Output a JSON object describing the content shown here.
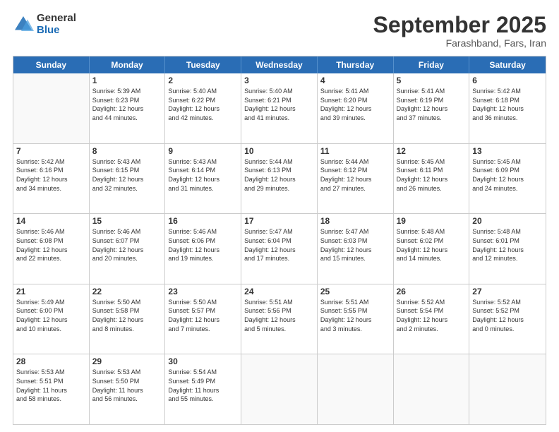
{
  "logo": {
    "general": "General",
    "blue": "Blue"
  },
  "header": {
    "month": "September 2025",
    "location": "Farashband, Fars, Iran"
  },
  "weekdays": [
    "Sunday",
    "Monday",
    "Tuesday",
    "Wednesday",
    "Thursday",
    "Friday",
    "Saturday"
  ],
  "rows": [
    [
      {
        "day": "",
        "empty": true
      },
      {
        "day": "1",
        "rise": "Sunrise: 5:39 AM",
        "set": "Sunset: 6:23 PM",
        "day_hours": "Daylight: 12 hours",
        "day_min": "and 44 minutes."
      },
      {
        "day": "2",
        "rise": "Sunrise: 5:40 AM",
        "set": "Sunset: 6:22 PM",
        "day_hours": "Daylight: 12 hours",
        "day_min": "and 42 minutes."
      },
      {
        "day": "3",
        "rise": "Sunrise: 5:40 AM",
        "set": "Sunset: 6:21 PM",
        "day_hours": "Daylight: 12 hours",
        "day_min": "and 41 minutes."
      },
      {
        "day": "4",
        "rise": "Sunrise: 5:41 AM",
        "set": "Sunset: 6:20 PM",
        "day_hours": "Daylight: 12 hours",
        "day_min": "and 39 minutes."
      },
      {
        "day": "5",
        "rise": "Sunrise: 5:41 AM",
        "set": "Sunset: 6:19 PM",
        "day_hours": "Daylight: 12 hours",
        "day_min": "and 37 minutes."
      },
      {
        "day": "6",
        "rise": "Sunrise: 5:42 AM",
        "set": "Sunset: 6:18 PM",
        "day_hours": "Daylight: 12 hours",
        "day_min": "and 36 minutes."
      }
    ],
    [
      {
        "day": "7",
        "rise": "Sunrise: 5:42 AM",
        "set": "Sunset: 6:16 PM",
        "day_hours": "Daylight: 12 hours",
        "day_min": "and 34 minutes."
      },
      {
        "day": "8",
        "rise": "Sunrise: 5:43 AM",
        "set": "Sunset: 6:15 PM",
        "day_hours": "Daylight: 12 hours",
        "day_min": "and 32 minutes."
      },
      {
        "day": "9",
        "rise": "Sunrise: 5:43 AM",
        "set": "Sunset: 6:14 PM",
        "day_hours": "Daylight: 12 hours",
        "day_min": "and 31 minutes."
      },
      {
        "day": "10",
        "rise": "Sunrise: 5:44 AM",
        "set": "Sunset: 6:13 PM",
        "day_hours": "Daylight: 12 hours",
        "day_min": "and 29 minutes."
      },
      {
        "day": "11",
        "rise": "Sunrise: 5:44 AM",
        "set": "Sunset: 6:12 PM",
        "day_hours": "Daylight: 12 hours",
        "day_min": "and 27 minutes."
      },
      {
        "day": "12",
        "rise": "Sunrise: 5:45 AM",
        "set": "Sunset: 6:11 PM",
        "day_hours": "Daylight: 12 hours",
        "day_min": "and 26 minutes."
      },
      {
        "day": "13",
        "rise": "Sunrise: 5:45 AM",
        "set": "Sunset: 6:09 PM",
        "day_hours": "Daylight: 12 hours",
        "day_min": "and 24 minutes."
      }
    ],
    [
      {
        "day": "14",
        "rise": "Sunrise: 5:46 AM",
        "set": "Sunset: 6:08 PM",
        "day_hours": "Daylight: 12 hours",
        "day_min": "and 22 minutes."
      },
      {
        "day": "15",
        "rise": "Sunrise: 5:46 AM",
        "set": "Sunset: 6:07 PM",
        "day_hours": "Daylight: 12 hours",
        "day_min": "and 20 minutes."
      },
      {
        "day": "16",
        "rise": "Sunrise: 5:46 AM",
        "set": "Sunset: 6:06 PM",
        "day_hours": "Daylight: 12 hours",
        "day_min": "and 19 minutes."
      },
      {
        "day": "17",
        "rise": "Sunrise: 5:47 AM",
        "set": "Sunset: 6:04 PM",
        "day_hours": "Daylight: 12 hours",
        "day_min": "and 17 minutes."
      },
      {
        "day": "18",
        "rise": "Sunrise: 5:47 AM",
        "set": "Sunset: 6:03 PM",
        "day_hours": "Daylight: 12 hours",
        "day_min": "and 15 minutes."
      },
      {
        "day": "19",
        "rise": "Sunrise: 5:48 AM",
        "set": "Sunset: 6:02 PM",
        "day_hours": "Daylight: 12 hours",
        "day_min": "and 14 minutes."
      },
      {
        "day": "20",
        "rise": "Sunrise: 5:48 AM",
        "set": "Sunset: 6:01 PM",
        "day_hours": "Daylight: 12 hours",
        "day_min": "and 12 minutes."
      }
    ],
    [
      {
        "day": "21",
        "rise": "Sunrise: 5:49 AM",
        "set": "Sunset: 6:00 PM",
        "day_hours": "Daylight: 12 hours",
        "day_min": "and 10 minutes."
      },
      {
        "day": "22",
        "rise": "Sunrise: 5:50 AM",
        "set": "Sunset: 5:58 PM",
        "day_hours": "Daylight: 12 hours",
        "day_min": "and 8 minutes."
      },
      {
        "day": "23",
        "rise": "Sunrise: 5:50 AM",
        "set": "Sunset: 5:57 PM",
        "day_hours": "Daylight: 12 hours",
        "day_min": "and 7 minutes."
      },
      {
        "day": "24",
        "rise": "Sunrise: 5:51 AM",
        "set": "Sunset: 5:56 PM",
        "day_hours": "Daylight: 12 hours",
        "day_min": "and 5 minutes."
      },
      {
        "day": "25",
        "rise": "Sunrise: 5:51 AM",
        "set": "Sunset: 5:55 PM",
        "day_hours": "Daylight: 12 hours",
        "day_min": "and 3 minutes."
      },
      {
        "day": "26",
        "rise": "Sunrise: 5:52 AM",
        "set": "Sunset: 5:54 PM",
        "day_hours": "Daylight: 12 hours",
        "day_min": "and 2 minutes."
      },
      {
        "day": "27",
        "rise": "Sunrise: 5:52 AM",
        "set": "Sunset: 5:52 PM",
        "day_hours": "Daylight: 12 hours",
        "day_min": "and 0 minutes."
      }
    ],
    [
      {
        "day": "28",
        "rise": "Sunrise: 5:53 AM",
        "set": "Sunset: 5:51 PM",
        "day_hours": "Daylight: 11 hours",
        "day_min": "and 58 minutes."
      },
      {
        "day": "29",
        "rise": "Sunrise: 5:53 AM",
        "set": "Sunset: 5:50 PM",
        "day_hours": "Daylight: 11 hours",
        "day_min": "and 56 minutes."
      },
      {
        "day": "30",
        "rise": "Sunrise: 5:54 AM",
        "set": "Sunset: 5:49 PM",
        "day_hours": "Daylight: 11 hours",
        "day_min": "and 55 minutes."
      },
      {
        "day": "",
        "empty": true
      },
      {
        "day": "",
        "empty": true
      },
      {
        "day": "",
        "empty": true
      },
      {
        "day": "",
        "empty": true
      }
    ]
  ]
}
